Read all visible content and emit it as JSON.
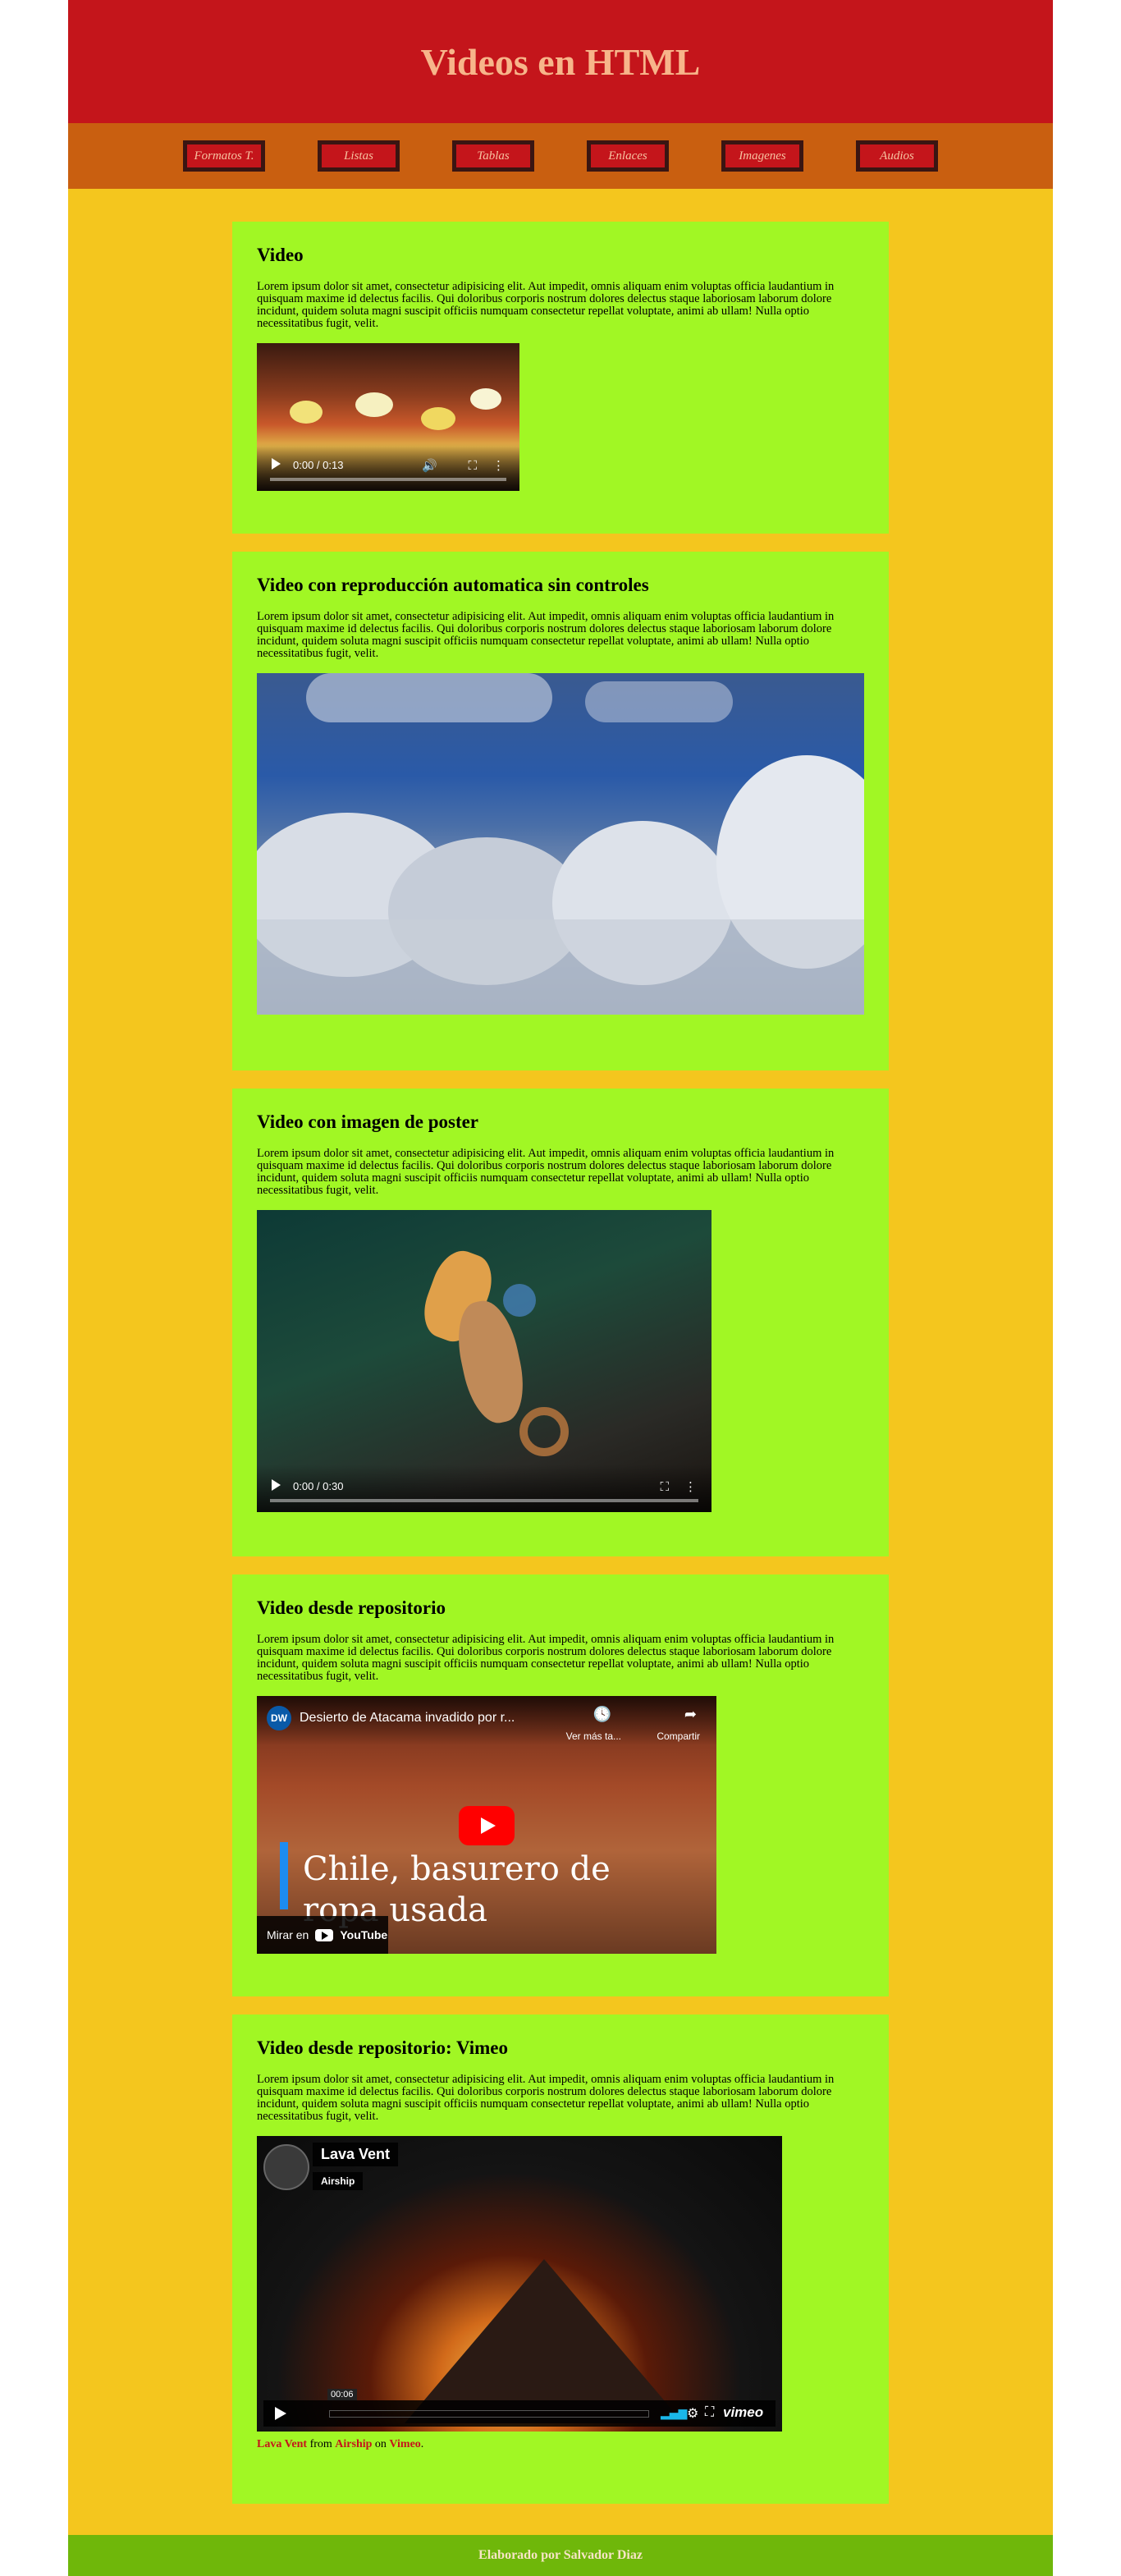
{
  "header": {
    "title": "Videos en HTML"
  },
  "nav": [
    {
      "label": "Formatos T."
    },
    {
      "label": "Listas"
    },
    {
      "label": "Tablas"
    },
    {
      "label": "Enlaces"
    },
    {
      "label": "Imagenes"
    },
    {
      "label": "Audios"
    }
  ],
  "lorem": "Lorem ipsum dolor sit amet, consectetur adipisicing elit. Aut impedit, omnis aliquam enim voluptas officia laudantium in quisquam maxime id delectus facilis. Qui doloribus corporis nostrum dolores delectus staque laboriosam laborum dolore incidunt, quidem soluta magni suscipit officiis numquam consectetur repellat voluptate, animi ab ullam! Nulla optio necessitatibus fugit, velit.",
  "sections": [
    {
      "title": "Video",
      "time": "0:00 / 0:13"
    },
    {
      "title": "Video con reproducción automatica sin controles"
    },
    {
      "title": "Video con imagen de poster",
      "time": "0:00 / 0:30"
    },
    {
      "title": "Video desde repositorio",
      "yt_title": "Desierto de Atacama invadido por r...",
      "yt_watch_later": "Ver más ta...",
      "yt_share": "Compartir",
      "yt_headline": "Chile, basurero de ropa usada",
      "yt_watch_on": "Mirar en",
      "yt_brand": "YouTube",
      "yt_channel": "DW"
    },
    {
      "title": "Video desde repositorio: Vimeo",
      "vimeo_title": "Lava Vent",
      "vimeo_user": "Airship",
      "vimeo_time": "00:06",
      "vimeo_brand": "vimeo",
      "caption_title": "Lava Vent",
      "caption_from": " from ",
      "caption_user": "Airship",
      "caption_on": " on ",
      "caption_site": "Vimeo",
      "caption_end": "."
    }
  ],
  "footer": {
    "text": "Elaborado por Salvador Diaz"
  },
  "colors": {
    "header": "#c4151b",
    "nav": "#c95f10",
    "page": "#f4c61e",
    "card": "#a1f724",
    "footer": "#6fb70a"
  }
}
